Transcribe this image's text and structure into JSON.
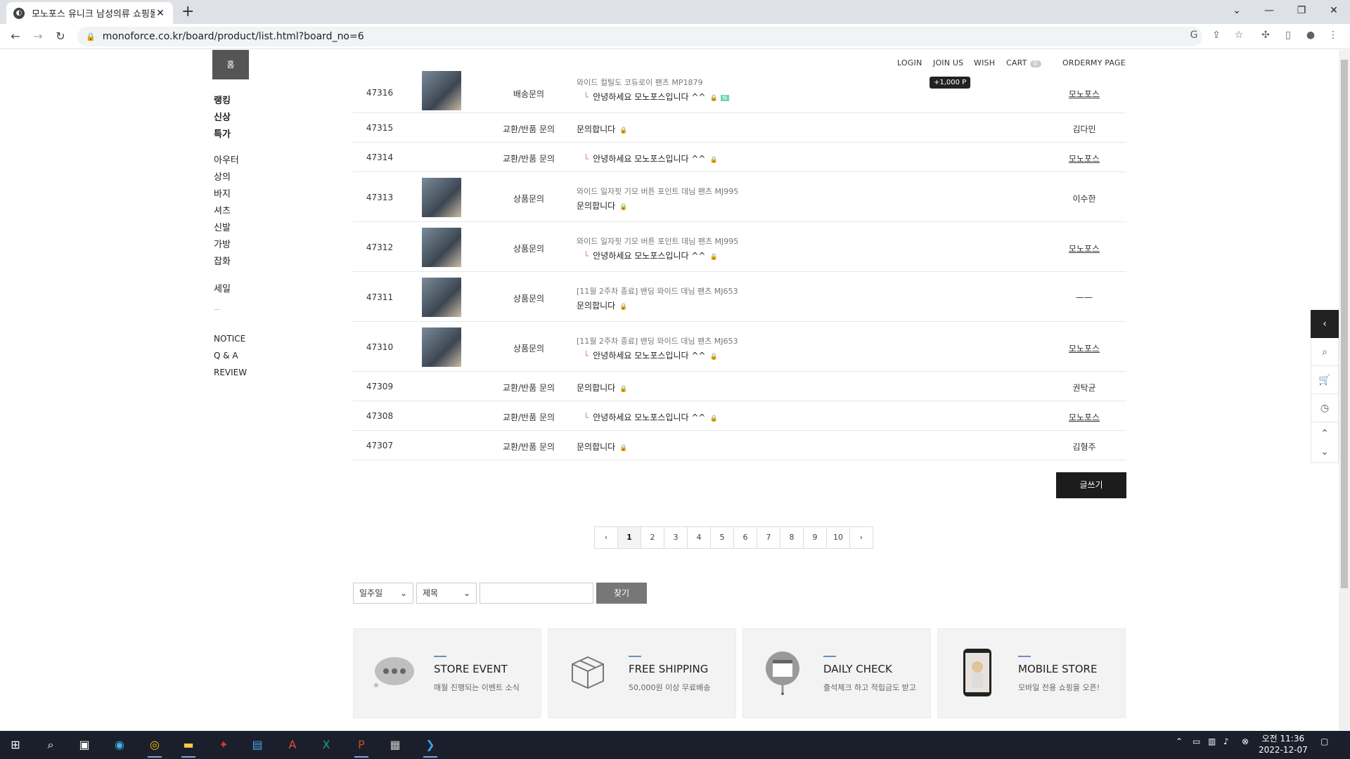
{
  "browser": {
    "tab_title": "모노포스 유니크 남성의류 쇼핑몰",
    "tab_close": "✕",
    "new_tab": "+",
    "url": "monoforce.co.kr/board/product/list.html?board_no=6"
  },
  "site": {
    "home_label": "홈",
    "top_nav": [
      "LOGIN",
      "JOIN US",
      "WISH",
      "CART",
      "ORDER",
      "MY PAGE"
    ],
    "cart_count": "0",
    "point_tooltip": "+1,000 P",
    "sidebar_main": [
      "랭킹",
      "신상",
      "특가"
    ],
    "sidebar_categories": [
      "아우터",
      "상의",
      "바지",
      "셔츠",
      "신발",
      "가방",
      "잡화"
    ],
    "sidebar_sale": "세일",
    "sidebar_divider": "—",
    "sidebar_board": [
      "NOTICE",
      "Q & A",
      "REVIEW"
    ]
  },
  "board": {
    "rows": [
      {
        "no": "47316",
        "thumb": true,
        "category": "배송문의",
        "product": "와이드 컬틸도 코듀로이 팬츠 MP1879",
        "subject": "안녕하세요 모노포스입니다 ^^",
        "reply": true,
        "new": true,
        "author": "모노포스",
        "author_link": true
      },
      {
        "no": "47315",
        "thumb": false,
        "category": "교환/반품 문의",
        "product": "",
        "subject": "문의합니다",
        "reply": false,
        "new": false,
        "author": "김다민",
        "author_link": false
      },
      {
        "no": "47314",
        "thumb": false,
        "category": "교환/반품 문의",
        "product": "",
        "subject": "안녕하세요 모노포스입니다 ^^",
        "reply": true,
        "new": false,
        "author": "모노포스",
        "author_link": true
      },
      {
        "no": "47313",
        "thumb": true,
        "category": "상품문의",
        "product": "와이드 일자핏 기모 버튼 포인트 데님 팬츠 MJ995",
        "subject": "문의합니다",
        "reply": false,
        "new": false,
        "author": "이수한",
        "author_link": false
      },
      {
        "no": "47312",
        "thumb": true,
        "category": "상품문의",
        "product": "와이드 일자핏 기모 버튼 포인트 데님 팬츠 MJ995",
        "subject": "안녕하세요 모노포스입니다 ^^",
        "reply": true,
        "new": false,
        "author": "모노포스",
        "author_link": true
      },
      {
        "no": "47311",
        "thumb": true,
        "category": "상품문의",
        "product": "[11월 2주차 종료] 밴딩 와이드 데님 팬츠 MJ653",
        "subject": "문의합니다",
        "reply": false,
        "new": false,
        "author": "——",
        "author_link": false
      },
      {
        "no": "47310",
        "thumb": true,
        "category": "상품문의",
        "product": "[11월 2주차 종료] 밴딩 와이드 데님 팬츠 MJ653",
        "subject": "안녕하세요 모노포스입니다 ^^",
        "reply": true,
        "new": false,
        "author": "모노포스",
        "author_link": true
      },
      {
        "no": "47309",
        "thumb": false,
        "category": "교환/반품 문의",
        "product": "",
        "subject": "문의합니다",
        "reply": false,
        "new": false,
        "author": "권탁균",
        "author_link": false
      },
      {
        "no": "47308",
        "thumb": false,
        "category": "교환/반품 문의",
        "product": "",
        "subject": "안녕하세요 모노포스입니다 ^^",
        "reply": true,
        "new": false,
        "author": "모노포스",
        "author_link": true
      },
      {
        "no": "47307",
        "thumb": false,
        "category": "교환/반품 문의",
        "product": "",
        "subject": "문의합니다",
        "reply": false,
        "new": false,
        "author": "김형주",
        "author_link": false
      }
    ],
    "write_label": "글쓰기",
    "lock_glyph": "🔒",
    "new_badge": "N",
    "pages": [
      "1",
      "2",
      "3",
      "4",
      "5",
      "6",
      "7",
      "8",
      "9",
      "10"
    ],
    "current_page": "1",
    "prev": "‹",
    "next": "›"
  },
  "search": {
    "period": "일주일",
    "field": "제목",
    "keyword": "",
    "button": "찾기"
  },
  "banners": [
    {
      "title": "STORE EVENT",
      "subtitle": "매월 진행되는 이벤트 소식",
      "icon": "chat-bubble-icon"
    },
    {
      "title": "FREE SHIPPING",
      "subtitle": "50,000원 이상 무료배송",
      "icon": "box-icon"
    },
    {
      "title": "DAILY CHECK",
      "subtitle": "출석체크 하고 적립금도 받고",
      "icon": "calendar-pin-icon"
    },
    {
      "title": "MOBILE STORE",
      "subtitle": "모바일 전용 쇼핑을 오픈!",
      "icon": "phone-icon"
    }
  ],
  "taskbar": {
    "time": "오전 11:36",
    "date": "2022-12-07"
  },
  "colors": {
    "accent_dark": "#1c1c1c",
    "reply_mark": "#e57373",
    "new_badge": "#6fd3b8",
    "taskbar": "#1b1f2b"
  }
}
